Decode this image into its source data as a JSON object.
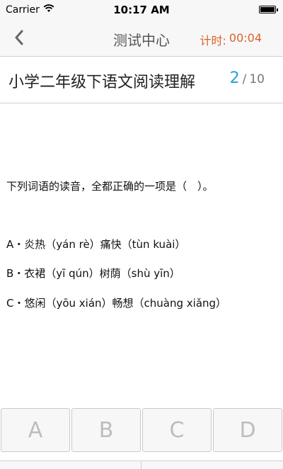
{
  "status_bar": {
    "carrier": "Carrier",
    "time": "10:17 AM",
    "icons": [
      "wifi-icon",
      "battery-icon"
    ]
  },
  "nav": {
    "back_icon": "chevron-left-icon",
    "title": "测试中心",
    "timer_label": "计时:",
    "timer_value": "00:04",
    "timer_color": "#d9622b"
  },
  "quiz": {
    "title": "小学二年级下语文阅读理解",
    "current": "2",
    "separator": "/",
    "total": "10",
    "accent_color": "#2a9fd8"
  },
  "question": {
    "text": "下列词语的读音，全都正确的一项是（　）。",
    "options": [
      "A・炎热（yán rè）痛快（tùn kuài）",
      "B・衣裙（yī qún）树荫（shù yīn）",
      "C・悠闲（yōu xián）畅想（chuàng xiǎng）"
    ]
  },
  "answers": [
    "A",
    "B",
    "C",
    "D"
  ]
}
